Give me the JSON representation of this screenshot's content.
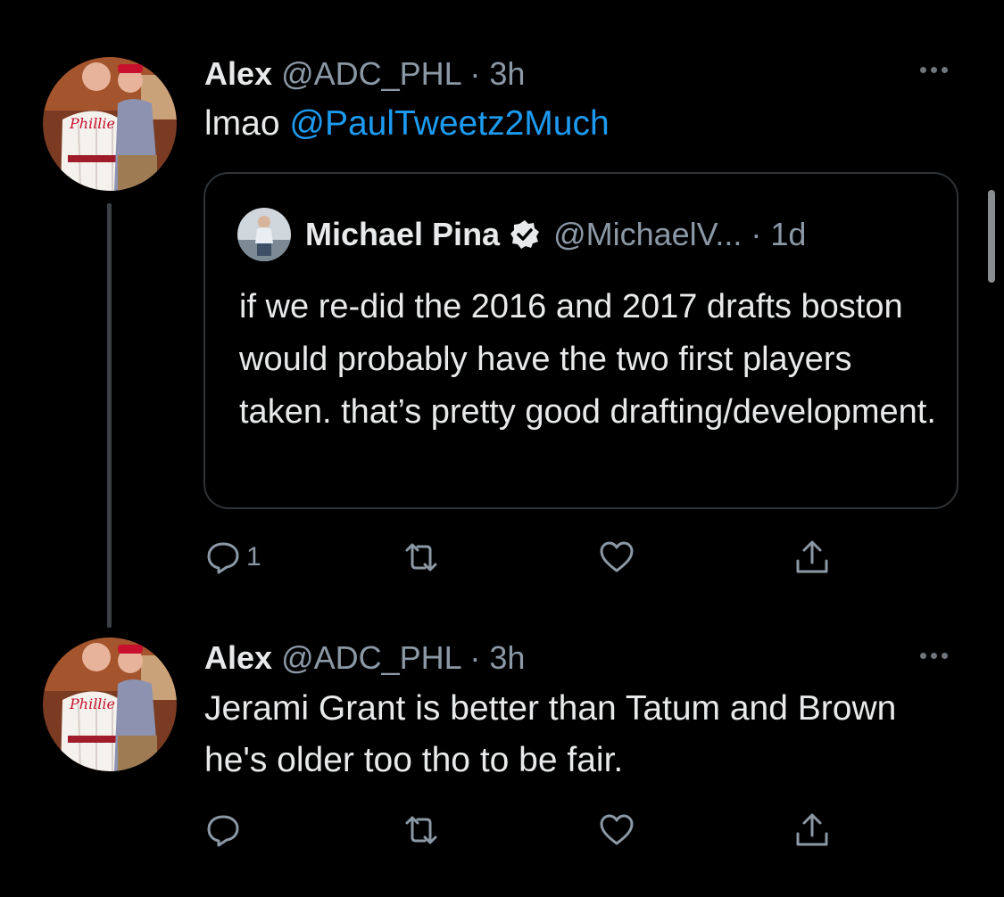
{
  "tweets": [
    {
      "name": "Alex",
      "handle": "@ADC_PHL",
      "time": "· 3h",
      "text_prefix": "lmao ",
      "mention": "@PaulTweetz2Much",
      "actions": {
        "reply_count": "1",
        "retweet_count": "",
        "like_count": ""
      }
    },
    {
      "name": "Alex",
      "handle": "@ADC_PHL",
      "time": "· 3h",
      "text": "Jerami Grant is better than Tatum and Brown he's older too tho to be fair.",
      "actions": {
        "reply_count": "",
        "retweet_count": "",
        "like_count": ""
      }
    }
  ],
  "quote": {
    "name": "Michael Pina",
    "handle": "@MichaelV...",
    "time": "· 1d",
    "text": "if we re-did the 2016 and 2017 drafts boston would probably have the two first players taken. that’s pretty good drafting/development."
  },
  "icons": {
    "reply": "reply-icon",
    "retweet": "retweet-icon",
    "like": "heart-icon",
    "share": "share-icon",
    "more": "more-icon",
    "verified": "verified-badge-icon"
  },
  "colors": {
    "background": "#000000",
    "link": "#1d9bf0",
    "secondary": "#8b98a5",
    "primary_text": "#e7e9ea"
  }
}
